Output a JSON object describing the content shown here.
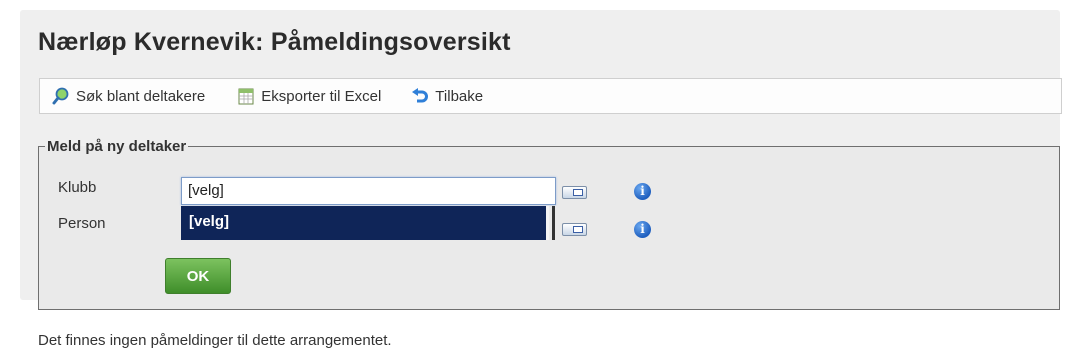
{
  "page": {
    "title": "Nærløp Kvernevik: Påmeldingsoversikt"
  },
  "toolbar": {
    "items": [
      {
        "label": "Søk blant deltakere",
        "icon": "search-icon"
      },
      {
        "label": "Eksporter til Excel",
        "icon": "spreadsheet-icon"
      },
      {
        "label": "Tilbake",
        "icon": "back-arrow-icon"
      }
    ]
  },
  "form": {
    "legend": "Meld på ny deltaker",
    "klubb": {
      "label": "Klubb",
      "value": "[velg]"
    },
    "person": {
      "label": "Person",
      "dropdown_selected": "[velg]"
    },
    "ok_label": "OK"
  },
  "status_text": "Det finnes ingen påmeldinger til dette arrangementet.",
  "colors": {
    "accent": "#0f2558",
    "ok_button": "#4f9e36",
    "info": "#1f5fbf"
  }
}
